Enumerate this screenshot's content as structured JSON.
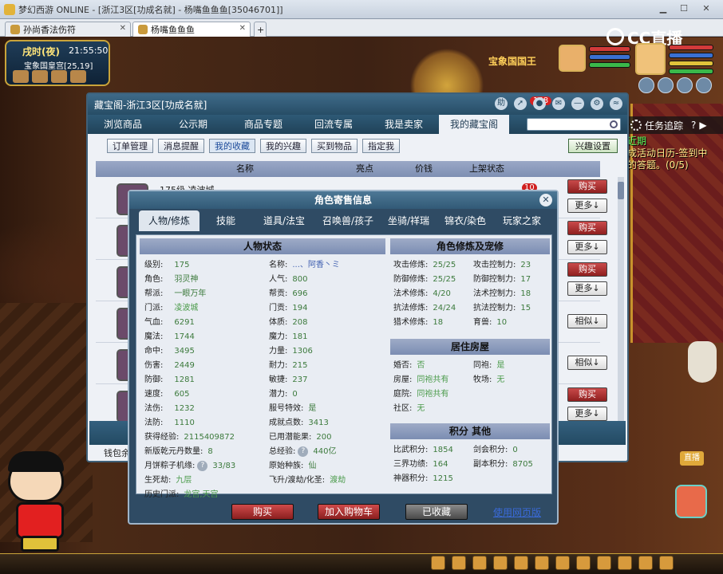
{
  "browser": {
    "title": "梦幻西游 ONLINE - [浙江3区[功成名就] - 杨嘴鱼鱼鱼[35046701]]",
    "tabs": [
      {
        "label": "孙尚香法伤符",
        "active": false
      },
      {
        "label": "杨嘴鱼鱼鱼",
        "active": true
      }
    ],
    "add_tab": "+"
  },
  "hud": {
    "time_label": "戌时(夜)",
    "clock": "21:55:50",
    "location": "宝象国皇宫[25,19]",
    "npc_title": "宝象国国王",
    "stream_logo": "CC直播",
    "task_tracking": "任务追踪",
    "task_text_1": "近期",
    "task_text_2": "成活动日历-签到中",
    "task_text_3": "的答题。(0/5)",
    "live_label": "直播"
  },
  "window": {
    "title": "藏宝阁-浙江3区[功成名就]",
    "notif_count": "158",
    "nav": [
      "浏览商品",
      "公示期",
      "商品专题",
      "回流专属",
      "我是卖家",
      "我的藏宝阁"
    ],
    "nav_active": 5,
    "subnav": [
      "订单管理",
      "消息提醒",
      "我的收藏",
      "我的兴趣",
      "买到物品",
      "指定我"
    ],
    "subnav_active": 2,
    "interest_button": "兴趣设置",
    "columns": [
      "名称",
      "亮点",
      "价钱",
      "上架状态"
    ],
    "row_preview": "175级 凌波城",
    "row_count": "10",
    "buttons": {
      "buy": "购买",
      "more": "更多↓",
      "similar": "相似↓"
    },
    "wallet": "钱包余"
  },
  "modal": {
    "title": "角色寄售信息",
    "tabs": [
      "人物/修炼",
      "技能",
      "道具/法宝",
      "召唤兽/孩子",
      "坐骑/祥瑞",
      "锦衣/染色",
      "玩家之家"
    ],
    "tab_active": 0,
    "status_header": "人物状态",
    "status_left": [
      {
        "k": "级别:",
        "v": "175"
      },
      {
        "k": "角色:",
        "v": "羽灵神"
      },
      {
        "k": "帮派:",
        "v": "一眼万年"
      },
      {
        "k": "门派:",
        "v": "凌波城"
      },
      {
        "k": "气血:",
        "v": "6291"
      },
      {
        "k": "魔法:",
        "v": "1744"
      },
      {
        "k": "命中:",
        "v": "3495"
      },
      {
        "k": "伤害:",
        "v": "2449"
      },
      {
        "k": "防御:",
        "v": "1281"
      },
      {
        "k": "速度:",
        "v": "605"
      },
      {
        "k": "法伤:",
        "v": "1232"
      },
      {
        "k": "法防:",
        "v": "1110"
      }
    ],
    "status_right": [
      {
        "k": "名称:",
        "v": "...、阿香丶ミ"
      },
      {
        "k": "人气:",
        "v": "800"
      },
      {
        "k": "帮贡:",
        "v": "696"
      },
      {
        "k": "门贡:",
        "v": "194"
      },
      {
        "k": "体质:",
        "v": "208"
      },
      {
        "k": "魔力:",
        "v": "181"
      },
      {
        "k": "力量:",
        "v": "1306"
      },
      {
        "k": "耐力:",
        "v": "215"
      },
      {
        "k": "敏捷:",
        "v": "237"
      },
      {
        "k": "潜力:",
        "v": "0"
      },
      {
        "k": "服号特效:",
        "v": "是"
      },
      {
        "k": "成就点数:",
        "v": "3413"
      }
    ],
    "extra": [
      {
        "k": "获得经验:",
        "v": "2115409872"
      },
      {
        "k": "已用潜能果:",
        "v": "200"
      },
      {
        "k": "新版乾元丹数量:",
        "v": "8"
      },
      {
        "k": "总经验:",
        "v": "440亿"
      },
      {
        "k": "月饼粽子机缘:",
        "v": "33/83"
      },
      {
        "k": "原始种族:",
        "v": "仙"
      },
      {
        "k": "生死劫:",
        "v": "九层"
      },
      {
        "k": "飞升/渡劫/化圣:",
        "v": "渡劫"
      },
      {
        "k": "历史门派:",
        "v": "龙宫,天宫"
      }
    ],
    "cultivation_header": "角色修炼及宠修",
    "cultivation": [
      {
        "k": "攻击修炼:",
        "v": "25/25",
        "k2": "攻击控制力:",
        "v2": "23"
      },
      {
        "k": "防御修炼:",
        "v": "25/25",
        "k2": "防御控制力:",
        "v2": "17"
      },
      {
        "k": "法术修炼:",
        "v": "4/20",
        "k2": "法术控制力:",
        "v2": "18"
      },
      {
        "k": "抗法修炼:",
        "v": "24/24",
        "k2": "抗法控制力:",
        "v2": "15"
      },
      {
        "k": "猎术修炼:",
        "v": "18",
        "k2": "育兽:",
        "v2": "10"
      }
    ],
    "housing_header": "居住房屋",
    "housing": [
      {
        "k": "婚否:",
        "v": "否",
        "k2": "同袍:",
        "v2": "是"
      },
      {
        "k": "房屋:",
        "v": "同袍共有",
        "k2": "牧场:",
        "v2": "无"
      },
      {
        "k": "庭院:",
        "v": "同袍共有"
      },
      {
        "k": "社区:",
        "v": "无"
      }
    ],
    "score_header": "积分 其他",
    "scores": [
      {
        "k": "比武积分:",
        "v": "1854",
        "k2": "剑会积分:",
        "v2": "0"
      },
      {
        "k": "三界功绩:",
        "v": "164",
        "k2": "副本积分:",
        "v2": "8705"
      },
      {
        "k": "神器积分:",
        "v": "1215"
      }
    ],
    "buttons": {
      "buy": "购买",
      "add_cart": "加入购物车",
      "favorited": "已收藏",
      "web_version": "使用网页版"
    }
  },
  "colors": {
    "accent": "#2e5a76",
    "buy": "#b53232",
    "link": "#3a6ad8"
  }
}
